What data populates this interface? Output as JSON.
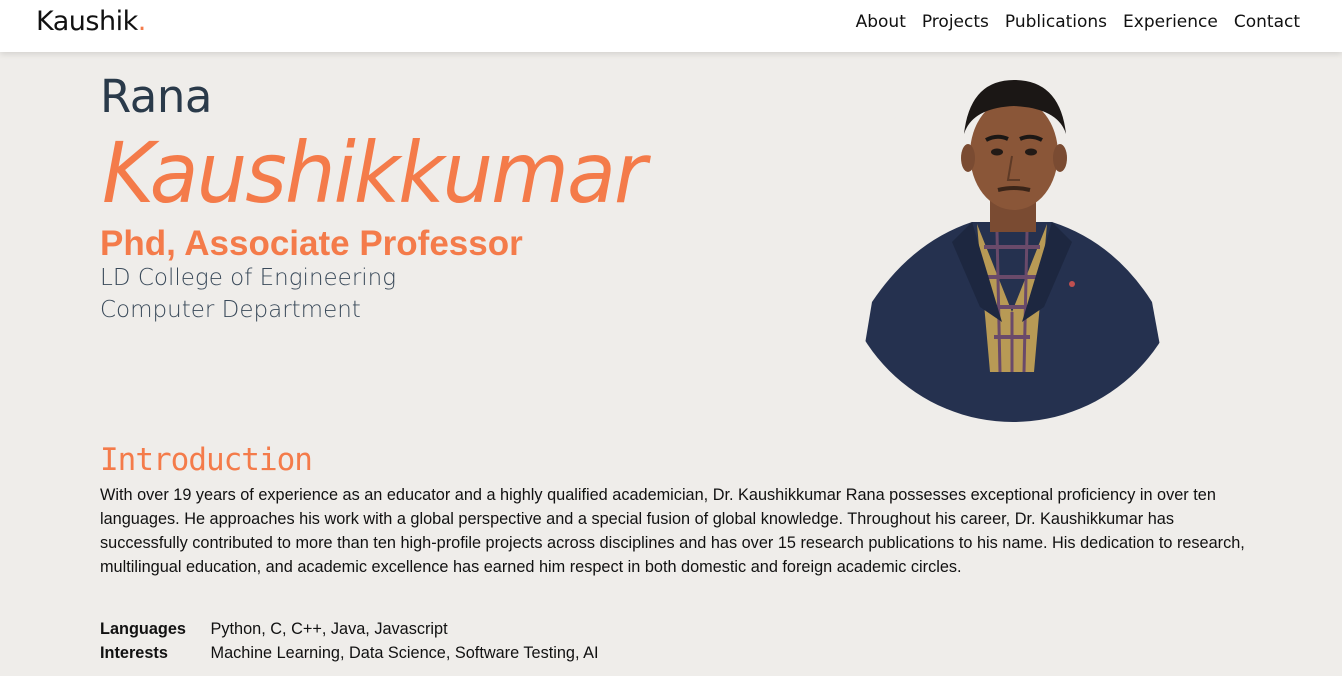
{
  "nav": {
    "brand": "Kaushik",
    "brand_dot": ".",
    "links": [
      "About",
      "Projects",
      "Publications",
      "Experience",
      "Contact"
    ]
  },
  "hero": {
    "first_name": "Rana",
    "last_name": "Kaushikkumar",
    "title": "Phd, Associate Professor",
    "college": "LD College of Engineering",
    "department": "Computer Department"
  },
  "intro": {
    "heading": "Introduction",
    "text": "With over 19 years of experience as an educator and a highly qualified academician, Dr. Kaushikkumar Rana possesses exceptional proficiency in over ten languages. He approaches his work with a global perspective and a special fusion of global knowledge. Throughout his career, Dr. Kaushikkumar has successfully contributed to more than ten high-profile projects across disciplines and has over 15 research publications to his name. His dedication to research, multilingual education, and academic excellence has earned him respect in both domestic and foreign academic circles."
  },
  "info": {
    "languages_label": "Languages",
    "languages_value": "Python, C, C++, Java, Javascript",
    "interests_label": "Interests",
    "interests_value": "Machine Learning, Data Science, Software Testing, AI"
  },
  "colors": {
    "accent": "#f47b4a",
    "background": "#efedea",
    "dark_text": "#2a3a4a"
  }
}
